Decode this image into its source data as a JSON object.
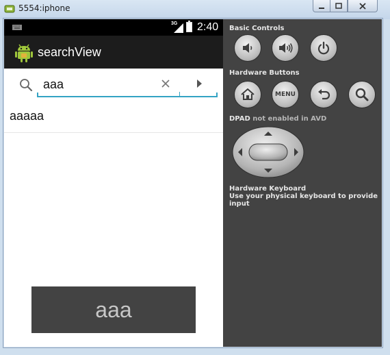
{
  "window": {
    "title": "5554:iphone"
  },
  "status_bar": {
    "network": "3G",
    "time": "2:40"
  },
  "action_bar": {
    "title": "searchView"
  },
  "search": {
    "value": "aaa",
    "accent_color": "#33a3c4"
  },
  "suggestions": [
    "aaaaa"
  ],
  "toast": {
    "text": "aaa"
  },
  "controls": {
    "basic_controls_label": "Basic Controls",
    "hardware_buttons_label": "Hardware Buttons",
    "menu_label": "MENU",
    "dpad_label": "DPAD",
    "dpad_status": "not enabled in AVD",
    "keyboard_title": "Hardware Keyboard",
    "keyboard_desc": "Use your physical keyboard to provide input"
  }
}
